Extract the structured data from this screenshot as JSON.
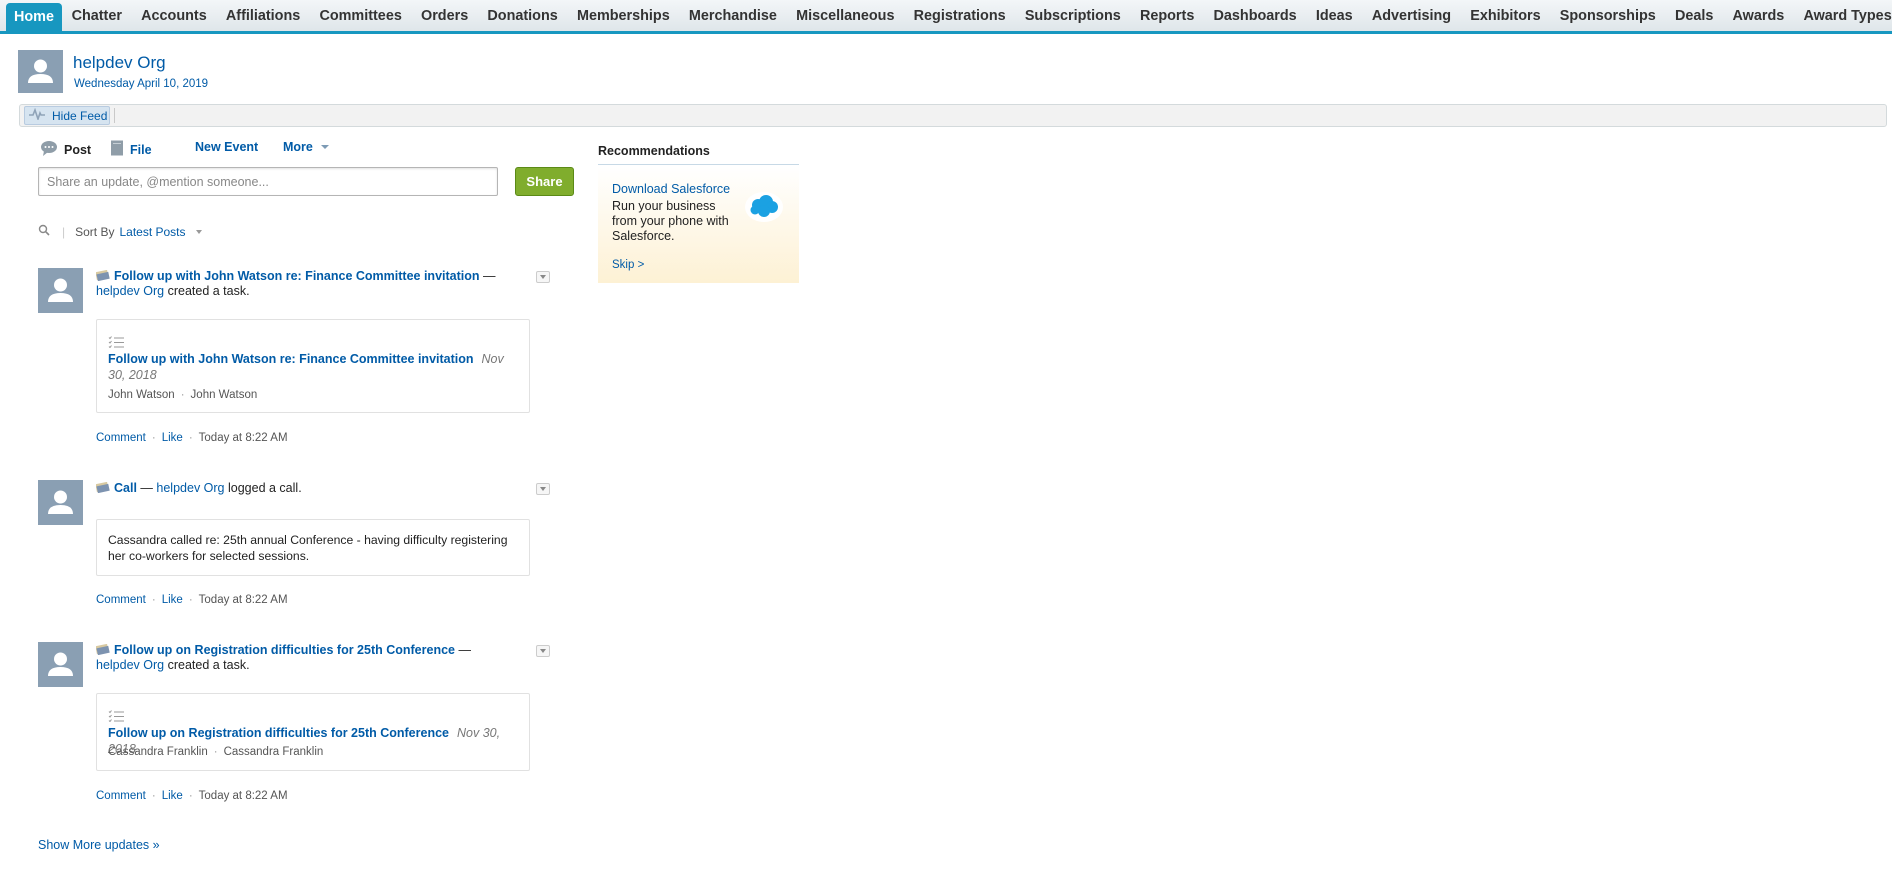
{
  "tabs": [
    {
      "label": "Home",
      "active": true
    },
    {
      "label": "Chatter"
    },
    {
      "label": "Accounts"
    },
    {
      "label": "Affiliations"
    },
    {
      "label": "Committees"
    },
    {
      "label": "Orders"
    },
    {
      "label": "Donations"
    },
    {
      "label": "Memberships"
    },
    {
      "label": "Merchandise"
    },
    {
      "label": "Miscellaneous"
    },
    {
      "label": "Registrations"
    },
    {
      "label": "Subscriptions"
    },
    {
      "label": "Reports"
    },
    {
      "label": "Dashboards"
    },
    {
      "label": "Ideas"
    },
    {
      "label": "Advertising"
    },
    {
      "label": "Exhibitors"
    },
    {
      "label": "Sponsorships"
    },
    {
      "label": "Deals"
    },
    {
      "label": "Awards"
    },
    {
      "label": "Award Types"
    }
  ],
  "tab_add": "+",
  "header": {
    "title": "helpdev Org",
    "date": "Wednesday April 10, 2019"
  },
  "feed_bar": {
    "hide_feed": "Hide Feed"
  },
  "publisher": {
    "post": "Post",
    "file": "File",
    "new_event": "New Event",
    "more": "More",
    "placeholder": "Share an update, @mention someone...",
    "share": "Share"
  },
  "sort": {
    "label": "Sort By",
    "value": "Latest Posts"
  },
  "feed": [
    {
      "title": "Follow up with John Watson re: Finance Committee invitation",
      "dash": "—",
      "actor": "helpdev Org",
      "action": "created a task.",
      "card_title": "Follow up with John Watson re: Finance Committee invitation",
      "card_date": "Nov 30, 2018",
      "card_sub1": "John Watson",
      "card_sub2": "John Watson",
      "comment": "Comment",
      "like": "Like",
      "time": "Today at 8:22 AM"
    },
    {
      "title": "Call",
      "dash": "—",
      "actor": "helpdev Org",
      "action": "logged a call.",
      "card_text": "Cassandra called re: 25th annual Conference - having difficulty registering her co-workers for selected sessions.",
      "comment": "Comment",
      "like": "Like",
      "time": "Today at 8:22 AM"
    },
    {
      "title": "Follow up on Registration difficulties for 25th Conference",
      "dash": "—",
      "actor": "helpdev Org",
      "action": "created a task.",
      "card_title": "Follow up on Registration difficulties for 25th Conference",
      "card_date": "Nov 30, 2018",
      "card_sub1": "Cassandra Franklin",
      "card_sub2": "Cassandra Franklin",
      "comment": "Comment",
      "like": "Like",
      "time": "Today at 8:22 AM"
    }
  ],
  "show_more": "Show More updates »",
  "recommendations": {
    "title": "Recommendations",
    "heading": "Download Salesforce",
    "body": "Run your business from your phone with Salesforce.",
    "skip": "Skip >"
  },
  "colors": {
    "accent": "#1797c0",
    "link": "#015ba7",
    "share_button": "#80ad2d",
    "avatar": "#8a9fb3"
  }
}
